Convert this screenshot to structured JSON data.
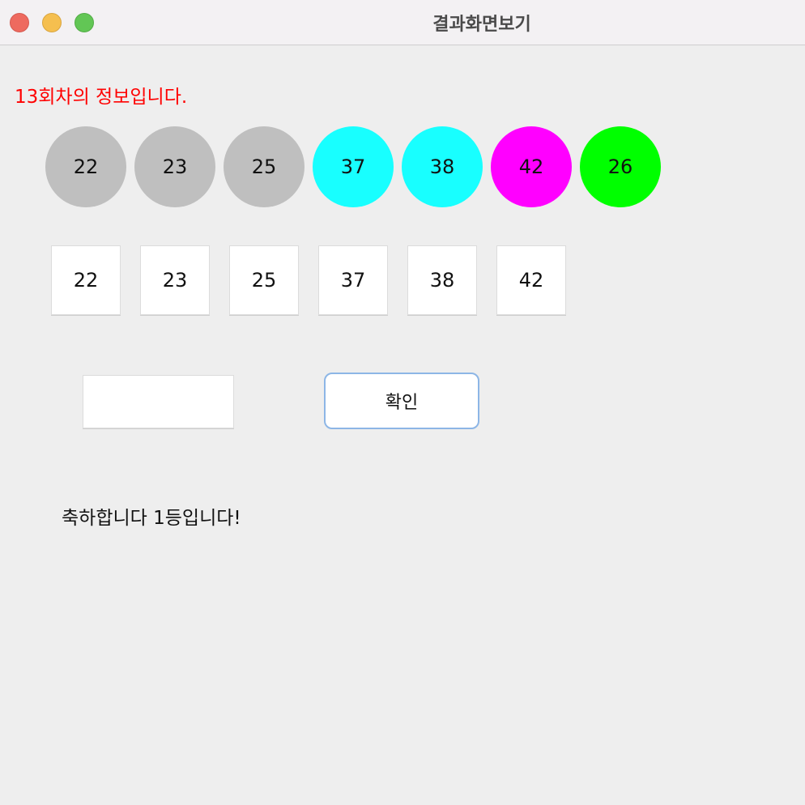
{
  "window": {
    "title": "결과화면보기"
  },
  "round_info": "13회차의 정보입니다.",
  "colors": {
    "round_info_text": "#ff0000",
    "ball_gray": "#bfbfbf",
    "ball_cyan": "#18ffff",
    "ball_magenta": "#ff00ff",
    "ball_green": "#00ff00",
    "button_border": "#8db6e6"
  },
  "balls": [
    {
      "number": "22",
      "color": "#bfbfbf"
    },
    {
      "number": "23",
      "color": "#bfbfbf"
    },
    {
      "number": "25",
      "color": "#bfbfbf"
    },
    {
      "number": "37",
      "color": "#18ffff"
    },
    {
      "number": "38",
      "color": "#18ffff"
    },
    {
      "number": "42",
      "color": "#ff00ff"
    },
    {
      "number": "26",
      "color": "#00ff00"
    }
  ],
  "picked_numbers": [
    "22",
    "23",
    "25",
    "37",
    "38",
    "42"
  ],
  "input": {
    "value": "",
    "placeholder": ""
  },
  "confirm_button": {
    "label": "확인"
  },
  "result_message": "축하합니다 1등입니다!"
}
